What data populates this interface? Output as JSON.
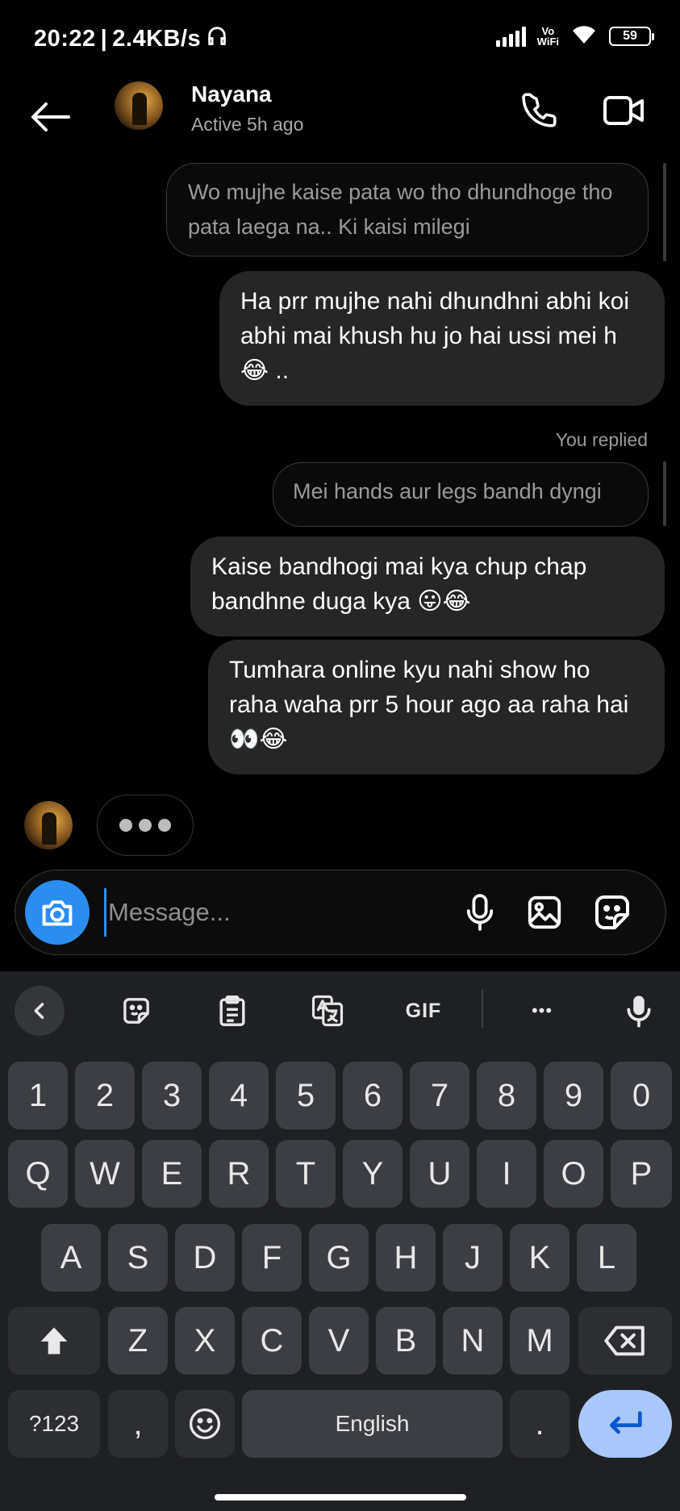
{
  "status_bar": {
    "time": "20:22",
    "separator": "|",
    "net_speed": "2.4KB/s",
    "vowifi_top": "Vo",
    "vowifi_bottom": "WiFi",
    "battery": "59"
  },
  "header": {
    "contact_name": "Nayana",
    "contact_status": "Active 5h ago"
  },
  "messages": {
    "quoted_1": "Wo mujhe kaise pata wo tho dhundhoge tho pata laega na.. Ki kaisi milegi",
    "sent_1": "Ha prr mujhe nahi dhundhni abhi koi abhi mai khush hu jo hai ussi mei h 😂 ..",
    "you_replied": "You replied",
    "quoted_2": "Mei hands aur legs bandh dyngi",
    "sent_2": "Kaise bandhogi mai kya chup chap bandhne duga kya 😛😂",
    "sent_3": "Tumhara online kyu nahi show ho raha waha prr 5 hour ago aa raha hai 👀😂"
  },
  "composer": {
    "placeholder": "Message..."
  },
  "keyboard": {
    "toolbar": {
      "gif_label": "GIF",
      "more_label": "•••"
    },
    "number_row": [
      "1",
      "2",
      "3",
      "4",
      "5",
      "6",
      "7",
      "8",
      "9",
      "0"
    ],
    "row_1": [
      "Q",
      "W",
      "E",
      "R",
      "T",
      "Y",
      "U",
      "I",
      "O",
      "P"
    ],
    "row_2": [
      "A",
      "S",
      "D",
      "F",
      "G",
      "H",
      "J",
      "K",
      "L"
    ],
    "row_3": [
      "Z",
      "X",
      "C",
      "V",
      "B",
      "N",
      "M"
    ],
    "bottom": {
      "symbols": "?123",
      "comma": ",",
      "space": "English",
      "period": "."
    }
  },
  "colors": {
    "accent_blue": "#2a8df0",
    "bubble_sent": "#262626",
    "keyboard_bg": "#1f2023",
    "key_bg": "#3c3e43",
    "enter_key": "#a8c7fa"
  }
}
